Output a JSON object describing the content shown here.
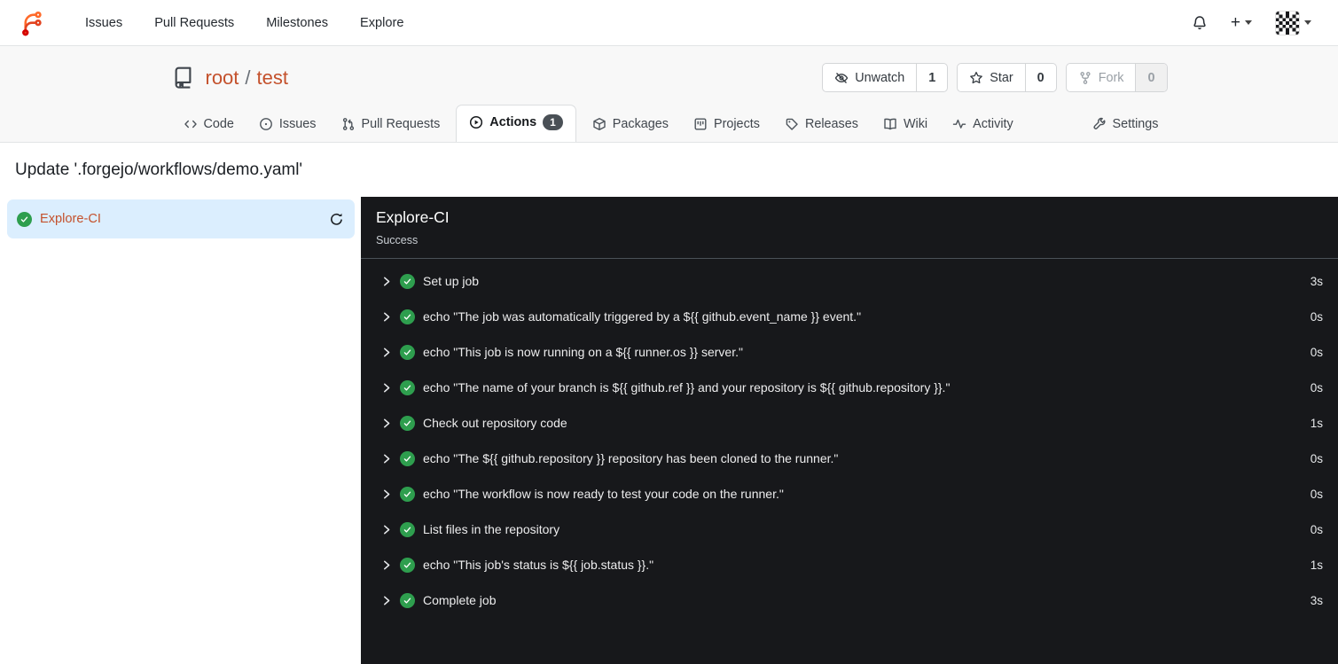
{
  "navbar": {
    "links": [
      {
        "label": "Issues"
      },
      {
        "label": "Pull Requests"
      },
      {
        "label": "Milestones"
      },
      {
        "label": "Explore"
      }
    ],
    "new_label": "+"
  },
  "repo": {
    "owner": "root",
    "separator": "/",
    "name": "test",
    "watch": {
      "label": "Unwatch",
      "count": "1"
    },
    "star": {
      "label": "Star",
      "count": "0"
    },
    "fork": {
      "label": "Fork",
      "count": "0"
    },
    "tabs": [
      {
        "label": "Code"
      },
      {
        "label": "Issues"
      },
      {
        "label": "Pull Requests"
      },
      {
        "label": "Actions",
        "badge": "1"
      },
      {
        "label": "Packages"
      },
      {
        "label": "Projects"
      },
      {
        "label": "Releases"
      },
      {
        "label": "Wiki"
      },
      {
        "label": "Activity"
      },
      {
        "label": "Settings"
      }
    ]
  },
  "run": {
    "title": "Update '.forgejo/workflows/demo.yaml'"
  },
  "sidebar": {
    "jobs": [
      {
        "name": "Explore-CI",
        "status": "success"
      }
    ]
  },
  "panel": {
    "title": "Explore-CI",
    "status": "Success",
    "steps": [
      {
        "name": "Set up job",
        "duration": "3s"
      },
      {
        "name": "echo \"The job was automatically triggered by a ${{ github.event_name }} event.\"",
        "duration": "0s"
      },
      {
        "name": "echo \"This job is now running on a ${{ runner.os }} server.\"",
        "duration": "0s"
      },
      {
        "name": "echo \"The name of your branch is ${{ github.ref }} and your repository is ${{ github.repository }}.\"",
        "duration": "0s"
      },
      {
        "name": "Check out repository code",
        "duration": "1s"
      },
      {
        "name": "echo \"The ${{ github.repository }} repository has been cloned to the runner.\"",
        "duration": "0s"
      },
      {
        "name": "echo \"The workflow is now ready to test your code on the runner.\"",
        "duration": "0s"
      },
      {
        "name": "List files in the repository",
        "duration": "0s"
      },
      {
        "name": "echo \"This job's status is ${{ job.status }}.\"",
        "duration": "1s"
      },
      {
        "name": "Complete job",
        "duration": "3s"
      }
    ]
  },
  "colors": {
    "primary_link": "#c4512c",
    "success_green": "#2e9e4e",
    "selected_job_bg": "#dbeefe",
    "panel_bg": "#17181b",
    "header_band_bg": "#f8f8f8"
  }
}
